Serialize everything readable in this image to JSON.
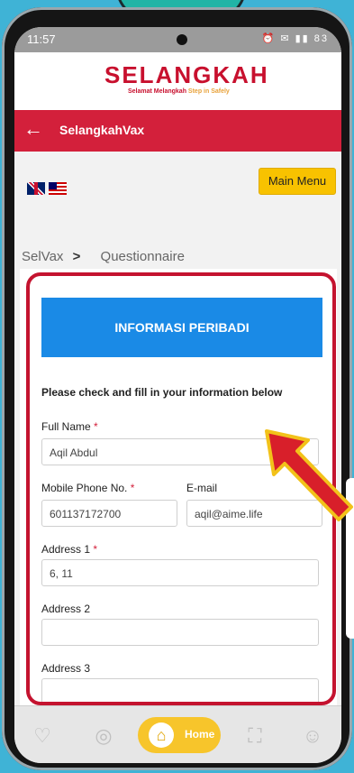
{
  "status_bar": {
    "time": "11:57",
    "right_icons": "⏰ ✉ ▮▮ 83"
  },
  "app": {
    "logo": "SELANGKAH",
    "logo_tagline": "Selamat Melangkah",
    "logo_tagline_en": "Step in Safely",
    "title": "SelangkahVax",
    "back_icon": "arrow-left-icon"
  },
  "toolbar": {
    "main_menu_label": "Main Menu"
  },
  "breadcrumb": {
    "root": "SelVax",
    "separator": ">",
    "current": "Questionnaire"
  },
  "form": {
    "banner": "INFORMASI PERIBADI",
    "instruction": "Please check and fill in your information below",
    "full_name": {
      "label": "Full Name",
      "required": "*",
      "value": "Aqil Abdul"
    },
    "mobile": {
      "label": "Mobile Phone No.",
      "required": "*",
      "value": "601137172700"
    },
    "email": {
      "label": "E-mail",
      "value": "aqil@aime.life"
    },
    "address1": {
      "label": "Address 1",
      "required": "*",
      "value": "6, 11"
    },
    "address2": {
      "label": "Address 2",
      "value": ""
    },
    "address3": {
      "label": "Address 3",
      "value": ""
    }
  },
  "nav": {
    "home_label": "Home",
    "icons": [
      "heart-icon",
      "globe-icon",
      "home-icon",
      "scan-icon",
      "people-icon"
    ]
  },
  "colors": {
    "brand_red": "#d3203b",
    "banner_blue": "#1a8ae6",
    "menu_yellow": "#f8c200",
    "highlight_red": "#c4132f"
  }
}
